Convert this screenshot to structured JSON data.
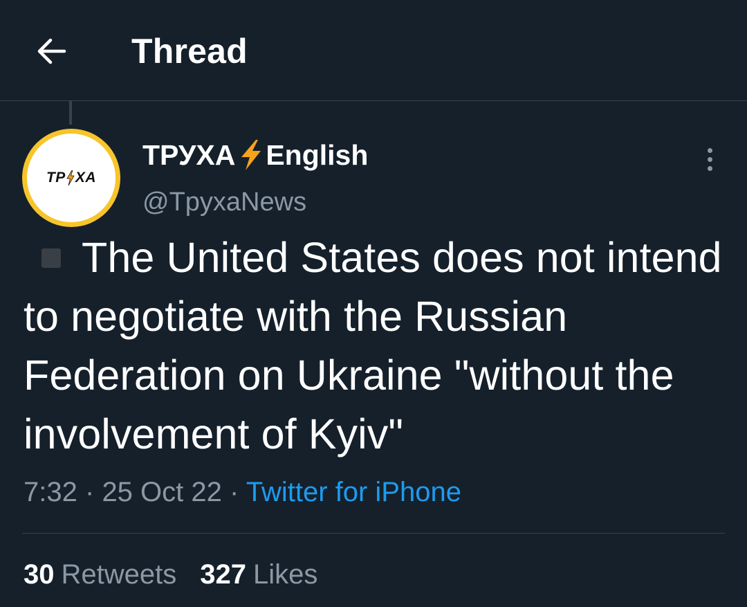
{
  "header": {
    "title": "Thread",
    "back_icon": "arrow-left-icon"
  },
  "tweet": {
    "avatar": {
      "logo_text_left": "ТР",
      "logo_text_right": "ХА",
      "ring_color": "#f7c52b"
    },
    "author": {
      "name_part1": "ТРУХА",
      "name_part2": "English",
      "name_emoji_icon": "lightning-bolt-icon",
      "handle": "@TpyxaNews"
    },
    "text_icon": "square-icon",
    "text": "The United States does not intend to negotiate with the Russian Federation on Ukraine \"without the involvement of Kyiv\"",
    "time": "7:32",
    "separator": "·",
    "date": "25 Oct 22",
    "source": "Twitter for iPhone",
    "stats": {
      "retweets_count": "30",
      "retweets_label": "Retweets",
      "likes_count": "327",
      "likes_label": "Likes"
    }
  },
  "colors": {
    "background": "#15202b",
    "text": "#ffffff",
    "secondary_text": "#8b98a5",
    "link": "#1d9bf0",
    "divider": "#38444d",
    "bolt": "#f7a21b"
  }
}
